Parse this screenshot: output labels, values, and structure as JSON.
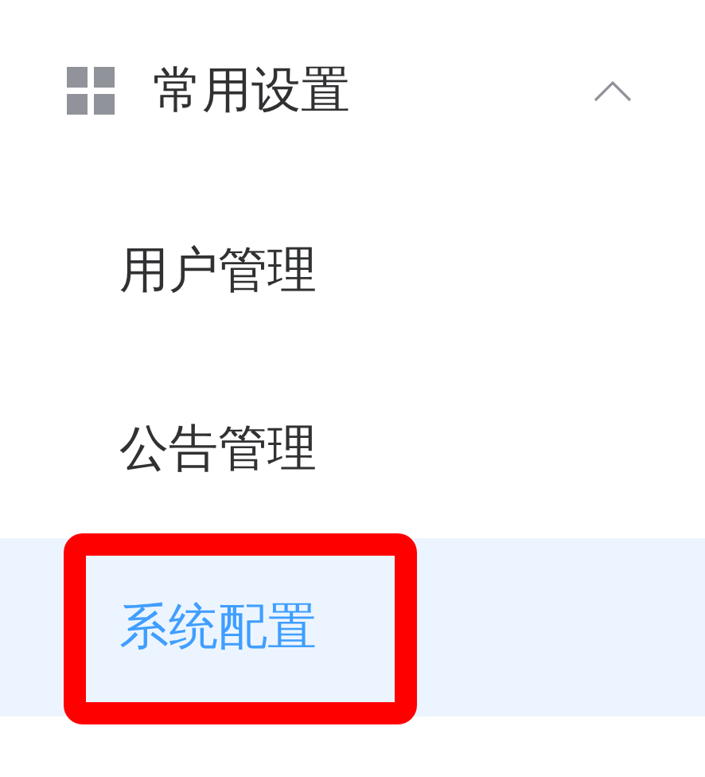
{
  "menu": {
    "title": "常用设置",
    "expanded": true,
    "items": [
      {
        "label": "用户管理",
        "selected": false,
        "annotated": false
      },
      {
        "label": "公告管理",
        "selected": false,
        "annotated": false
      },
      {
        "label": "系统配置",
        "selected": true,
        "annotated": true
      }
    ]
  }
}
